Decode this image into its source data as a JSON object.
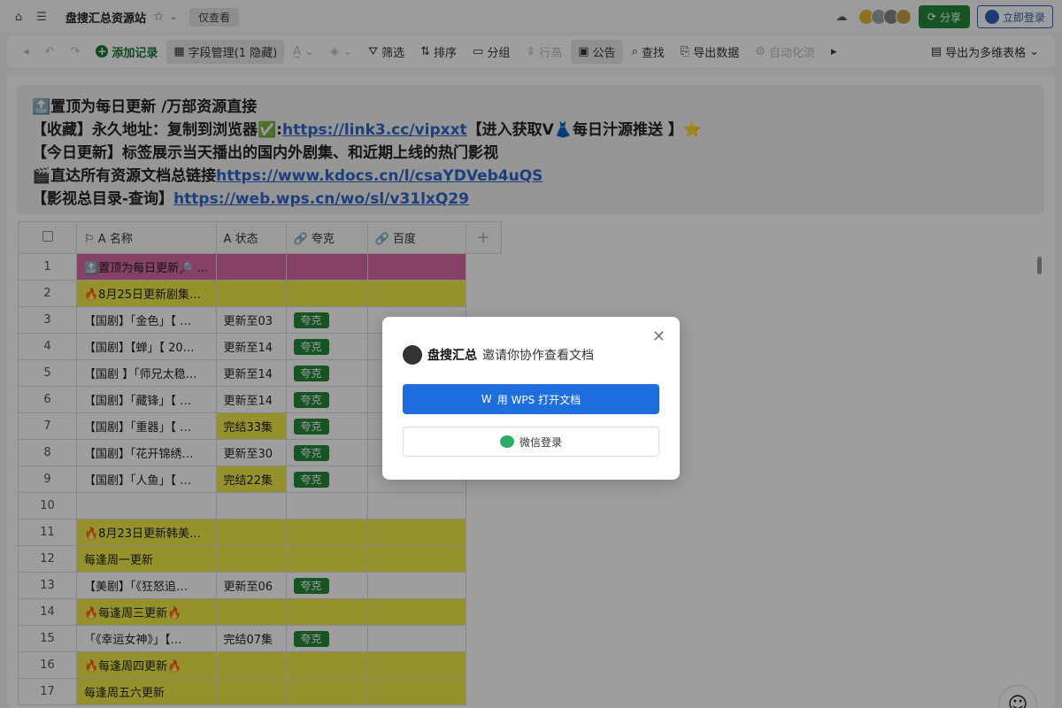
{
  "titlebar": {
    "title": "盘搜汇总资源站",
    "readonly": "仅查看",
    "share": "分享",
    "login": "立即登录"
  },
  "toolbar": {
    "add_record": "添加记录",
    "field_manage": "字段管理(1 隐藏)",
    "filter": "筛选",
    "sort": "排序",
    "group": "分组",
    "row_height": "行高",
    "notice": "公告",
    "find": "查找",
    "export": "导出数据",
    "automation": "自动化流",
    "export_multi": "导出为多维表格"
  },
  "notice": {
    "line1": "🔝置顶为每日更新 /万部资源直接",
    "line2_pre": "【收藏】永久地址：复制到浏览器✅:",
    "line2_link": "https://link3.cc/vipxxt",
    "line2_post": "【进入获取V👗每日汁源推送 】⭐",
    "line3": "【今日更新】标签展示当天播出的国内外剧集、和近期上线的热门影视",
    "line4_pre": "🎬直达所有资源文档总链接",
    "line4_link": "https://www.kdocs.cn/l/csaYDVeb4uQS",
    "line5_pre": "【影视总目录-查询】",
    "line5_link": "https://web.wps.cn/wo/sl/v31lxQ29"
  },
  "grid": {
    "headers": {
      "name": "名称",
      "status": "状态",
      "kuake": "夸克",
      "baidu": "百度"
    },
    "tag_label": "夸克",
    "rows": [
      {
        "n": "1",
        "name": "🔝置顶为每日更新🔎 …",
        "status": "",
        "tag": false,
        "style": "pink"
      },
      {
        "n": "2",
        "name": "🔥8月25日更新剧集…",
        "status": "",
        "tag": false,
        "style": "yellow"
      },
      {
        "n": "3",
        "name": "【国剧】「金色」【 …",
        "status": "更新至03",
        "tag": true,
        "style": ""
      },
      {
        "n": "4",
        "name": "【国剧】【蝉」【 20…",
        "status": "更新至14",
        "tag": true,
        "style": ""
      },
      {
        "n": "5",
        "name": "【国剧 】「师兄太稳…",
        "status": "更新至14",
        "tag": true,
        "style": ""
      },
      {
        "n": "6",
        "name": "【国剧】「藏锋」【 …",
        "status": "更新至14",
        "tag": true,
        "style": ""
      },
      {
        "n": "7",
        "name": "【国剧】「重器」【 …",
        "status": "完结33集",
        "tag": true,
        "style": "ystatus"
      },
      {
        "n": "8",
        "name": "【国剧】「花开锦绣…",
        "status": "更新至30",
        "tag": true,
        "style": ""
      },
      {
        "n": "9",
        "name": "【国剧】「人鱼」【 …",
        "status": "完结22集",
        "tag": true,
        "style": "ystatus"
      },
      {
        "n": "10",
        "name": "",
        "status": "",
        "tag": false,
        "style": ""
      },
      {
        "n": "11",
        "name": "🔥8月23日更新韩美…",
        "status": "",
        "tag": false,
        "style": "yellow"
      },
      {
        "n": "12",
        "name": "每逢周一更新",
        "status": "",
        "tag": false,
        "style": "yellow"
      },
      {
        "n": "13",
        "name": "【美剧】「《狂怒追…",
        "status": "更新至06",
        "tag": true,
        "style": ""
      },
      {
        "n": "14",
        "name": "🔥每逢周三更新🔥",
        "status": "",
        "tag": false,
        "style": "yellow"
      },
      {
        "n": "15",
        "name": "「《幸运女神》」【…",
        "status": "完结07集",
        "tag": true,
        "style": ""
      },
      {
        "n": "16",
        "name": "🔥每逢周四更新🔥",
        "status": "",
        "tag": false,
        "style": "yellow"
      },
      {
        "n": "17",
        "name": "每逢周五六更新",
        "status": "",
        "tag": false,
        "style": "yellow"
      }
    ]
  },
  "modal": {
    "user": "盘搜汇总",
    "invite": "邀请你协作查看文档",
    "wps_btn": "用 WPS 打开文档",
    "wx_btn": "微信登录"
  }
}
